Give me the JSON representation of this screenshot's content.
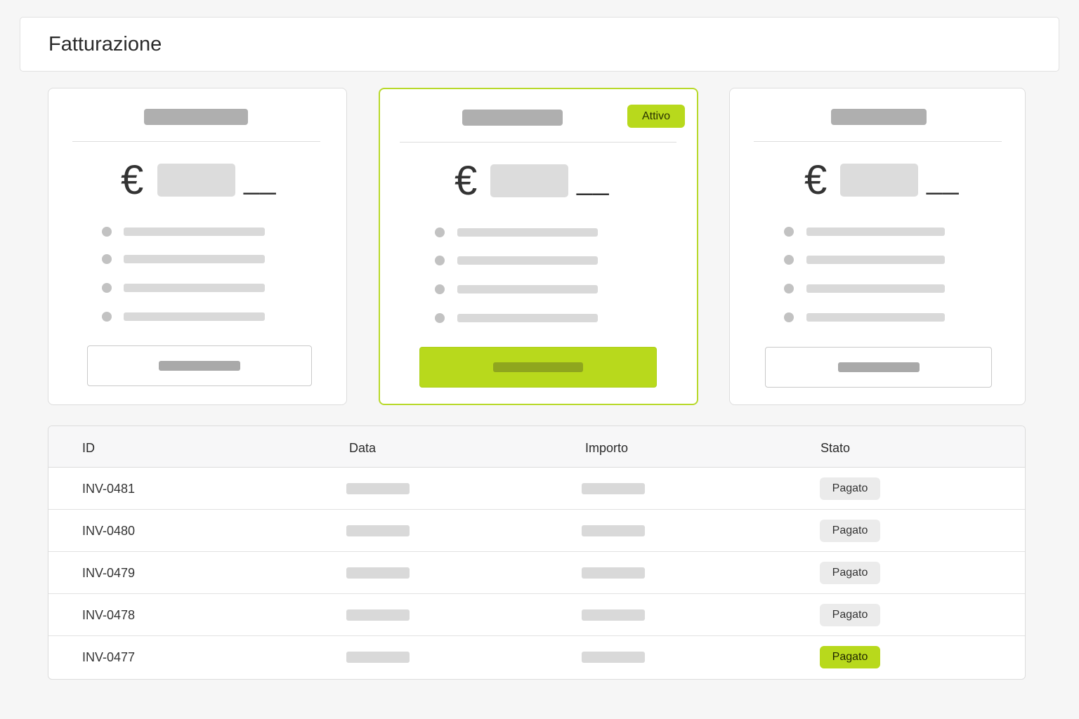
{
  "header": {
    "title": "Fatturazione"
  },
  "plans": [
    {
      "currency_symbol": "€",
      "period": "__",
      "active": false
    },
    {
      "currency_symbol": "€",
      "period": "__",
      "active": true,
      "badge": "Attivo"
    },
    {
      "currency_symbol": "€",
      "period": "__",
      "active": false
    }
  ],
  "colors": {
    "accent": "#b8d91c",
    "background": "#f6f6f6",
    "card": "#ffffff",
    "placeholder": "#d9d9d9"
  },
  "invoices": {
    "columns": [
      "ID",
      "Data",
      "Importo",
      "Stato"
    ],
    "rows": [
      {
        "id": "INV-0481",
        "status": "Pagato",
        "highlighted": false
      },
      {
        "id": "INV-0480",
        "status": "Pagato",
        "highlighted": false
      },
      {
        "id": "INV-0479",
        "status": "Pagato",
        "highlighted": false
      },
      {
        "id": "INV-0478",
        "status": "Pagato",
        "highlighted": false
      },
      {
        "id": "INV-0477",
        "status": "Pagato",
        "highlighted": true
      }
    ]
  }
}
